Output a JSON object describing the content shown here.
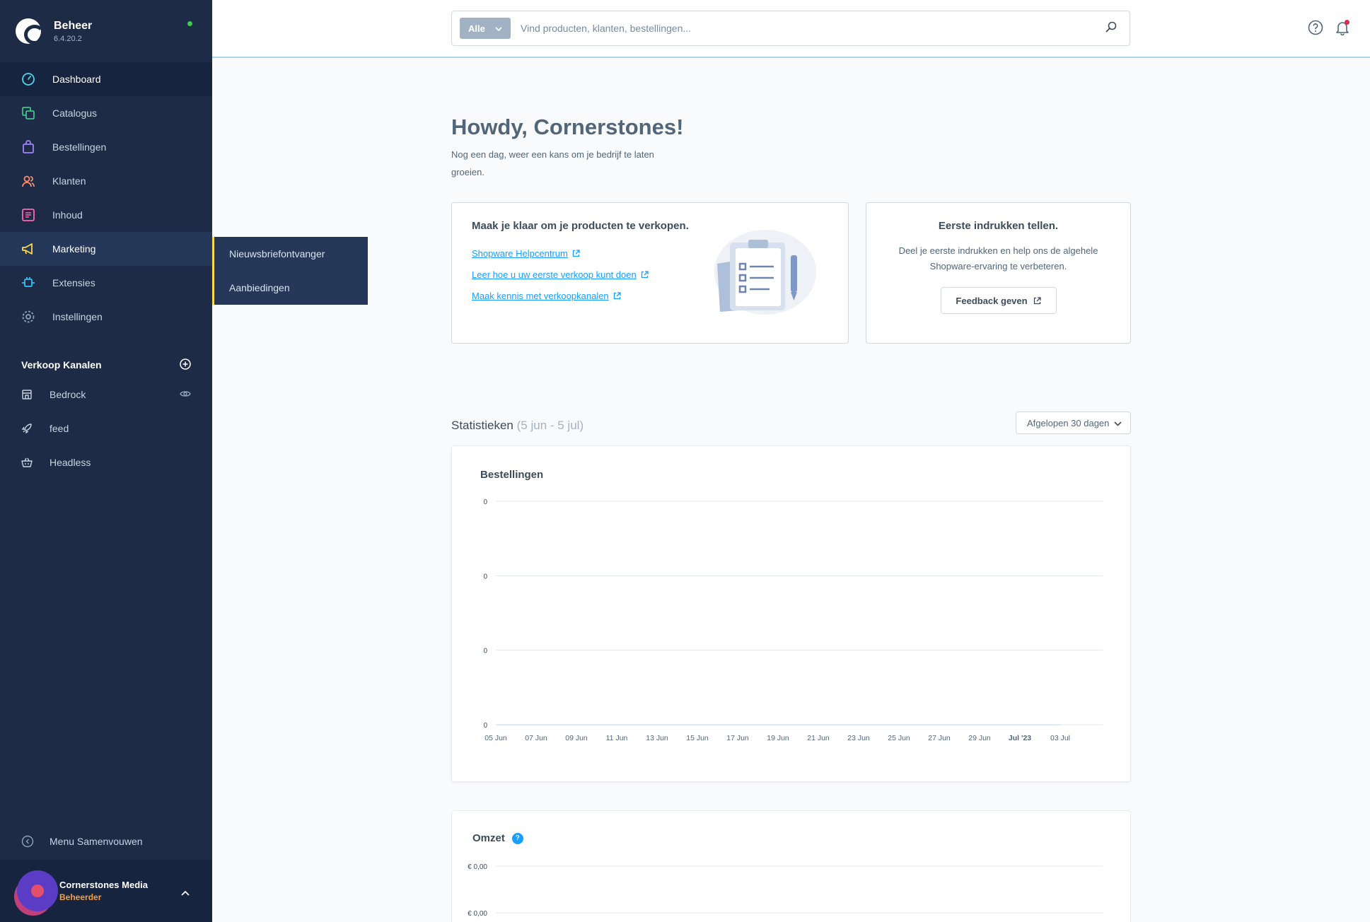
{
  "app": {
    "title": "Beheer",
    "version": "6.4.20.2"
  },
  "nav": {
    "items": [
      {
        "label": "Dashboard",
        "icon": "dashboard-icon"
      },
      {
        "label": "Catalogus",
        "icon": "catalog-icon"
      },
      {
        "label": "Bestellingen",
        "icon": "bag-icon"
      },
      {
        "label": "Klanten",
        "icon": "users-icon"
      },
      {
        "label": "Inhoud",
        "icon": "content-icon"
      },
      {
        "label": "Marketing",
        "icon": "megaphone-icon"
      },
      {
        "label": "Extensies",
        "icon": "plug-icon"
      },
      {
        "label": "Instellingen",
        "icon": "gear-icon"
      }
    ],
    "active": "Dashboard",
    "hovered": "Marketing"
  },
  "flyout": {
    "items": [
      "Nieuwsbriefontvanger",
      "Aanbiedingen"
    ]
  },
  "sales_channels": {
    "heading": "Verkoop Kanalen",
    "items": [
      {
        "label": "Bedrock",
        "icon": "storefront-icon"
      },
      {
        "label": "feed",
        "icon": "rocket-icon"
      },
      {
        "label": "Headless",
        "icon": "basket-icon"
      }
    ]
  },
  "collapse_label": "Menu Samenvouwen",
  "user": {
    "name": "Cornerstones Media",
    "role": "Beheerder"
  },
  "search": {
    "type": "Alle",
    "placeholder": "Vind producten, klanten, bestellingen..."
  },
  "greeting": {
    "title": "Howdy, Cornerstones!",
    "subtitle": "Nog een dag, weer een kans om je bedrijf te laten groeien."
  },
  "card_sell": {
    "title": "Maak je klaar om je producten te verkopen.",
    "links": [
      "Shopware Helpcentrum",
      "Leer hoe u uw eerste verkoop kunt doen",
      "Maak kennis met verkoopkanalen"
    ]
  },
  "card_feedback": {
    "title": "Eerste indrukken tellen.",
    "text": "Deel je eerste indrukken en help ons de algehele Shopware-ervaring te verbeteren.",
    "button": "Feedback geven"
  },
  "stats": {
    "title": "Statistieken",
    "range": "(5 jun - 5 jul)",
    "period": "Afgelopen 30 dagen"
  },
  "chart_data": [
    {
      "type": "line",
      "title": "Bestellingen",
      "x": [
        "05 Jun",
        "07 Jun",
        "09 Jun",
        "11 Jun",
        "13 Jun",
        "15 Jun",
        "17 Jun",
        "19 Jun",
        "21 Jun",
        "23 Jun",
        "25 Jun",
        "27 Jun",
        "29 Jun",
        "Jul '23",
        "03 Jul"
      ],
      "y_ticks": [
        "0",
        "0",
        "0",
        "0"
      ],
      "series": [
        {
          "values": [
            0,
            0,
            0,
            0,
            0,
            0,
            0,
            0,
            0,
            0,
            0,
            0,
            0,
            0,
            0
          ]
        }
      ],
      "grid": true
    },
    {
      "type": "line",
      "title": "Omzet",
      "y_ticks": [
        "€ 0,00",
        "€ 0,00"
      ],
      "grid": true
    }
  ],
  "colors": {
    "sidebar": "#1d2b47",
    "accent": "#189eff",
    "marketing_border": "#ffd94a"
  }
}
